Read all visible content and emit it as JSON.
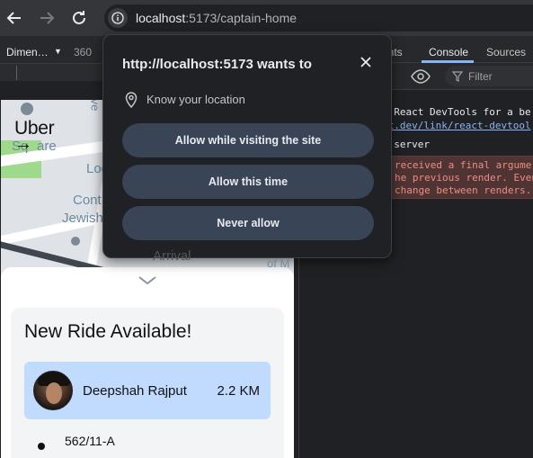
{
  "browser": {
    "url_host": "localhost",
    "url_rest": ":5173/captain-home"
  },
  "device_toolbar": {
    "dimension_label": "Dimen…",
    "width_value": "360"
  },
  "map": {
    "brand": "Uber",
    "labels": [
      "Loc",
      "Cont",
      "Jewish",
      "Sq",
      "are",
      "Arrival",
      "of M",
      "ve"
    ]
  },
  "ride_panel": {
    "title": "New Ride Available!",
    "rider_name": "Deepshah Rajput",
    "distance": "2.2 KM",
    "address": "562/11-A"
  },
  "devtools": {
    "tabs": [
      "ents",
      "Console",
      "Sources"
    ],
    "active_tab": "Console",
    "filter_placeholder": "Filter",
    "lines": {
      "l1": "e React DevTools for a be",
      "l2_link": "ct.dev/link/react-devtool",
      "l3": "o server"
    },
    "error_lines": [
      "received a final argume",
      "he previous render. Even",
      "change between renders."
    ],
    "colors": {
      "error_bg": "#4e3534",
      "error_text": "#f28b82",
      "link": "#8ab4f8"
    }
  },
  "permission_popup": {
    "title": "http://localhost:5173 wants to",
    "request": "Know your location",
    "buttons": {
      "allow_visiting": "Allow while visiting the site",
      "allow_once": "Allow this time",
      "never": "Never allow"
    },
    "colors": {
      "button_bg": "#394457"
    }
  }
}
